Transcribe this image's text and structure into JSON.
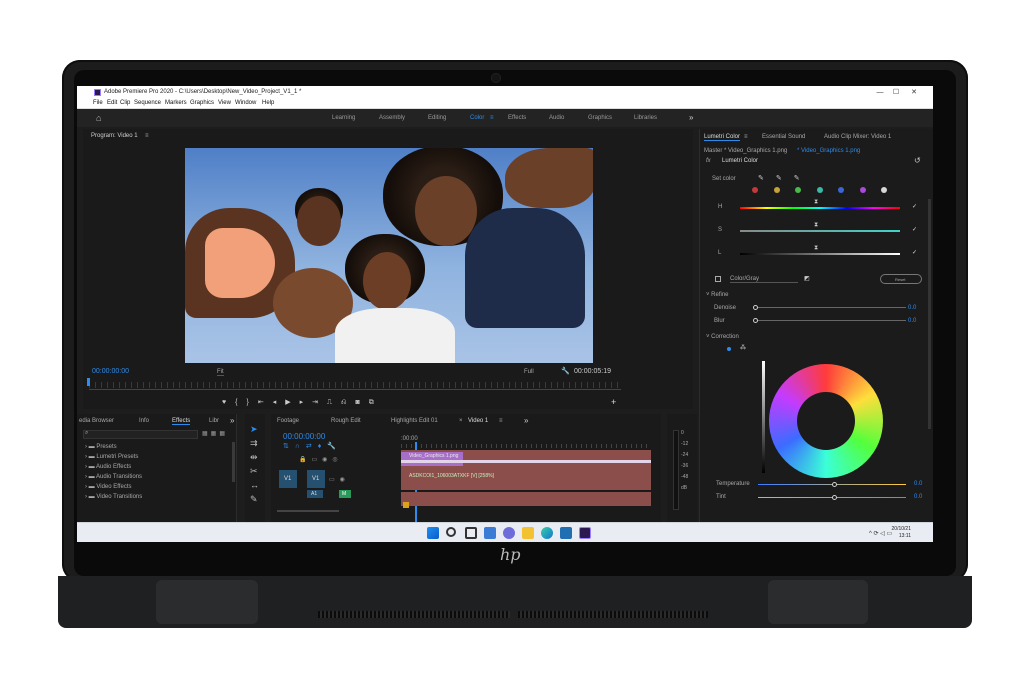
{
  "window": {
    "title": "Adobe Premiere Pro 2020 - C:\\Users\\Desktop\\New_Video_Project_V1_1 *",
    "controls": [
      "—",
      "☐",
      "✕"
    ]
  },
  "menubar": [
    "File",
    "Edit",
    "Clip",
    "Sequence",
    "Markers",
    "Graphics",
    "View",
    "Window",
    "Help"
  ],
  "workspaces": {
    "items": [
      "Learning",
      "Assembly",
      "Editing",
      "Color",
      "Effects",
      "Audio",
      "Graphics",
      "Libraries"
    ],
    "active": "Color",
    "more": "»"
  },
  "program": {
    "title": "Program: Video 1",
    "menu": "≡",
    "timecode_in": "00:00:00:00",
    "fit": "Fit",
    "quality": "Full",
    "timecode_out": "00:00:05:19",
    "add": "+"
  },
  "effects": {
    "tabs": [
      "edia Browser",
      "Info",
      "Effects",
      "Libr"
    ],
    "active_tab": "Effects",
    "more": "»",
    "items": [
      "Presets",
      "Lumetri Presets",
      "Audio Effects",
      "Audio Transitions",
      "Video Effects",
      "Video Transitions"
    ]
  },
  "timeline": {
    "tabs": [
      "Footage",
      "Rough Edit",
      "Highlights Edit 01",
      "Video 1"
    ],
    "active_tab": "Video 1",
    "more": "»",
    "close": "×",
    "menu": "≡",
    "timecode": "00:00:00:00",
    "ruler_label": ":00:00",
    "tracks": {
      "v1": "V1",
      "a1": "A1",
      "m": "M"
    },
    "clips": {
      "graphic": "Video_Graphics 1.png",
      "video": "ASDKCOI1_106003ATXKF [V] [258%]"
    }
  },
  "meter": {
    "ticks": [
      "0",
      "-12",
      "-24",
      "-36",
      "-48",
      "dB"
    ]
  },
  "lumetri": {
    "tabs": [
      "Lumetri Color",
      "Essential Sound",
      "Audio Clip Mixer: Video 1"
    ],
    "active_tab": "Lumetri Color",
    "menu": "≡",
    "source": "Master * Video_Graphics 1.png",
    "source_active": "* Video_Graphics 1.png",
    "fx": "fx",
    "effect_name": "Lumetri Color",
    "set_color": "Set color",
    "hsl": [
      "H",
      "S",
      "L"
    ],
    "color_gray": "Color/Gray",
    "reset": "Reset",
    "refine": "Refine",
    "denoise": "Denoise",
    "denoise_value": "0.0",
    "blur": "Blur",
    "blur_value": "0.0",
    "correction": "Correction",
    "temperature": "Temperature",
    "temperature_value": "0.0",
    "tint": "Tint",
    "tint_value": "0.0",
    "swatches": [
      "#c43a3a",
      "#c6a23a",
      "#49b948",
      "#3ab9a8",
      "#3a66d6",
      "#a94ad8",
      "#d7d7d7"
    ]
  },
  "taskbar": {
    "time": "20/10/21",
    "time2": "13:11",
    "tray": "^ ⟳ ◁ ▭"
  },
  "brand": {
    "logo": "hp"
  }
}
